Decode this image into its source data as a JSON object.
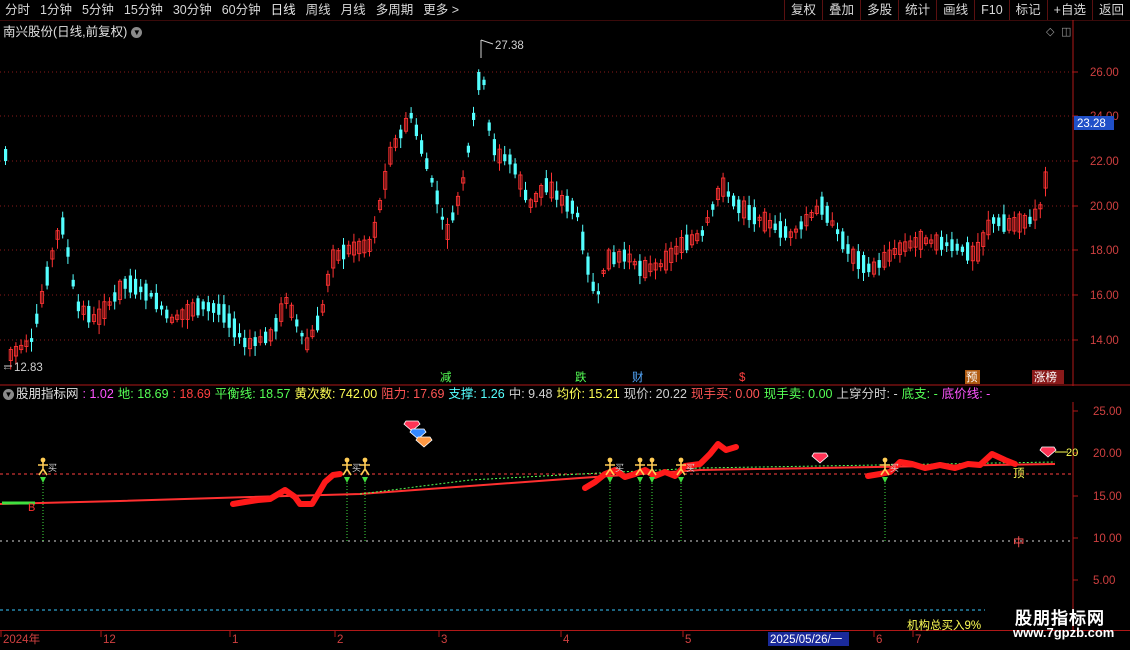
{
  "toolbar": {
    "tabs": [
      "分时",
      "1分钟",
      "5分钟",
      "15分钟",
      "30分钟",
      "60分钟",
      "日线",
      "周线",
      "月线",
      "多周期",
      "更多"
    ],
    "more_arrow": ">",
    "right_buttons": [
      "复权",
      "叠加",
      "多股",
      "统计",
      "画线",
      "F10",
      "标记",
      "+自选",
      "返回"
    ]
  },
  "main_chart": {
    "title": "南兴股份(日线,前复权)",
    "price_ticks": [
      "26.00",
      "24.00",
      "22.00",
      "20.00",
      "18.00",
      "16.00",
      "14.00"
    ],
    "current_price": "23.28",
    "high_label": "27.38",
    "low_label": "12.83",
    "markers": [
      "减",
      "跌",
      "财",
      "$",
      "预",
      "涨榜"
    ]
  },
  "indicator": {
    "name": "股朋指标网",
    "values": [
      {
        "k": "",
        "v": ": 1.02",
        "color": "#ff55ff"
      },
      {
        "k": "地: ",
        "v": "18.69",
        "color": "#55ff55"
      },
      {
        "k": ": ",
        "v": "18.69",
        "color": "#ff4040"
      },
      {
        "k": "平衡线: ",
        "v": "18.57",
        "color": "#55ff55"
      },
      {
        "k": "黄次数: ",
        "v": "742.00",
        "color": "#ffff55"
      },
      {
        "k": "阻力: ",
        "v": "17.69",
        "color": "#ff5555"
      },
      {
        "k": "支撑: ",
        "v": "1.26",
        "color": "#55ffff"
      },
      {
        "k": "中: ",
        "v": "9.48",
        "color": "#d0d0d0"
      },
      {
        "k": "均价: ",
        "v": "15.21",
        "color": "#ffff55"
      },
      {
        "k": "现价: ",
        "v": "20.22",
        "color": "#d0d0d0"
      },
      {
        "k": "现手买: ",
        "v": "0.00",
        "color": "#ff5555"
      },
      {
        "k": "现手卖: ",
        "v": "0.00",
        "color": "#55ff55"
      },
      {
        "k": "上穿分时: ",
        "v": "-",
        "color": "#d0d0d0"
      },
      {
        "k": "底支: ",
        "v": "-",
        "color": "#55ff55"
      },
      {
        "k": "底价线: ",
        "v": "-",
        "color": "#ff55ff"
      }
    ],
    "ticks": [
      "25.00",
      "20.00",
      "15.00",
      "10.00",
      "5.00"
    ],
    "labels": {
      "buy": "买",
      "ding": "顶",
      "zhong": "中",
      "b": "B",
      "right_value": "20"
    }
  },
  "timeline": {
    "labels": [
      "2024年",
      "12",
      "1",
      "2",
      "3",
      "4",
      "5",
      "6",
      "7"
    ],
    "date_box": "2025/05/26/一"
  },
  "footer": {
    "institution": "机构总买入9%",
    "watermark_title": "股朋指标网",
    "watermark_url": "www.7gpzb.com"
  },
  "colors": {
    "up": "#ff3232",
    "down": "#54ffff",
    "grid": "#8a1a1a",
    "axis": "#b01818"
  }
}
